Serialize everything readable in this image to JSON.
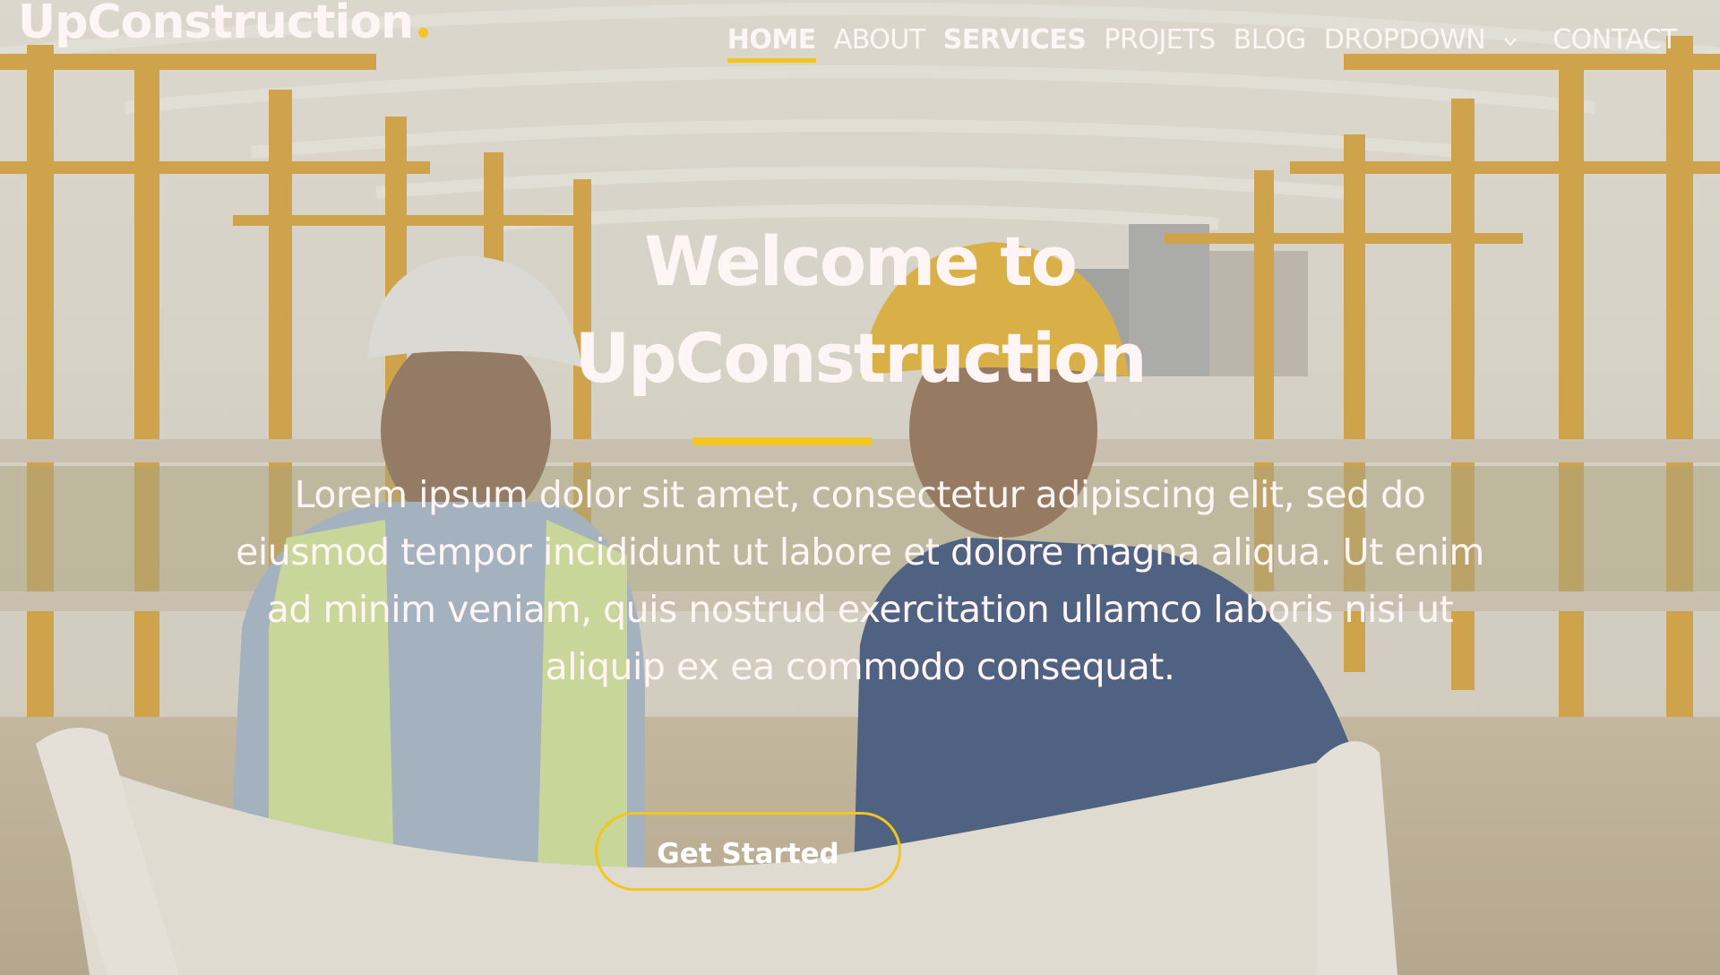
{
  "header": {
    "logo_text": "UpConstruction",
    "nav": [
      {
        "label": "HOME",
        "active": true,
        "bold": true
      },
      {
        "label": "ABOUT",
        "active": false,
        "bold": false
      },
      {
        "label": "SERVICES",
        "active": false,
        "bold": true
      },
      {
        "label": "PROJETS",
        "active": false,
        "bold": false
      },
      {
        "label": "BLOG",
        "active": false,
        "bold": false
      },
      {
        "label": "DROPDOWN",
        "active": false,
        "bold": false
      },
      {
        "label": "CONTACT",
        "active": false,
        "bold": false
      }
    ]
  },
  "hero": {
    "title_line1": "Welcome to",
    "title_line2": "UpConstruction",
    "text": "Lorem ipsum dolor sit amet, consectetur adipiscing elit, sed do eiusmod tempor incididunt ut labore et dolore magna aliqua. Ut enim ad minim veniam, quis nostrud exercitation ullamco laboris nisi ut aliquip ex ea commodo consequat.",
    "cta_label": "Get Started",
    "background_image": "construction-workers-reviewing-blueprints-photo"
  },
  "colors": {
    "accent": "#f4c41f",
    "text": "#fff5f5"
  },
  "icons": {
    "dropdown": "chevron-down-icon"
  }
}
